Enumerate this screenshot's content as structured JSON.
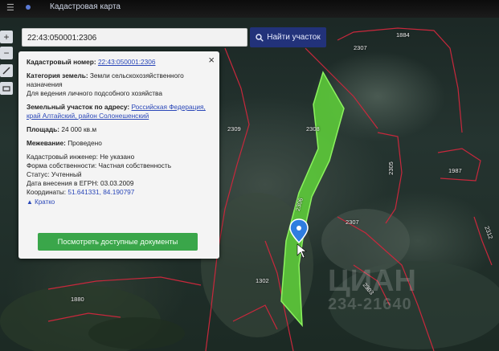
{
  "browser": {
    "title": "Кадастровая карта"
  },
  "search": {
    "value": "22:43:050001:2306",
    "button_label": "Найти участок"
  },
  "tools": {
    "zoom_in": "+",
    "zoom_out": "−"
  },
  "panel": {
    "cadastral_number": {
      "label": "Кадастровый номер:",
      "value": "22:43:050001:2306"
    },
    "land_category": {
      "label": "Категория земель:",
      "value": "Земли сельскохозяйственного назначения",
      "usage": "Для ведения личного подсобного хозяйства"
    },
    "address": {
      "label": "Земельный участок по адресу:",
      "value": "Российская Федерация, край Алтайский, район Солонешенский"
    },
    "area": {
      "label": "Площадь:",
      "value": "24 000 кв.м"
    },
    "boundary": {
      "label": "Межевание:",
      "value": "Проведено"
    },
    "engineer": {
      "label": "Кадастровый инженер:",
      "value": "Не указано"
    },
    "ownership": {
      "label": "Форма собственности:",
      "value": "Частная собственность"
    },
    "status": {
      "label": "Статус:",
      "value": "Учтенный"
    },
    "egrn_date": {
      "label": "Дата внесения в ЕГРН:",
      "value": "03.03.2009"
    },
    "coordinates": {
      "label": "Координаты:",
      "value": "51.641331, 84.190797"
    },
    "collapse_link": "Кратко",
    "docs_button": "Посмотреть доступные документы"
  },
  "map_labels": {
    "l1884": "1884",
    "l2307a": "2307",
    "l2309": "2309",
    "l2308": "2308",
    "l2305": "2305",
    "l1987": "1987",
    "l2306": "2306",
    "l2307b": "2307",
    "l1880": "1880",
    "l2303": "2303",
    "l1302": "1302",
    "l2312": "2312"
  },
  "watermark": {
    "text1": "ЦИАН",
    "text2": "234-21640"
  },
  "colors": {
    "parcel_fill": "#5fd23a",
    "parcel_stroke": "#8cf25f",
    "boundary": "#c8283c",
    "button_blue": "#22327a",
    "button_green": "#3aa64a"
  }
}
